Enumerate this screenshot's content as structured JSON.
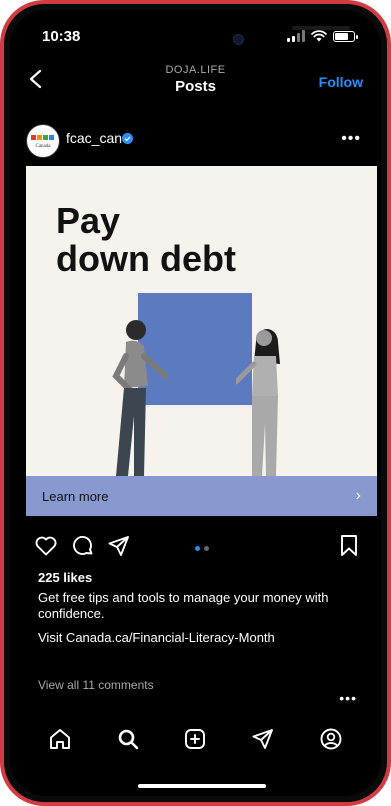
{
  "status_bar": {
    "time": "10:38"
  },
  "nav": {
    "subtitle": "DOJA.LIFE",
    "title": "Posts",
    "follow_label": "Follow"
  },
  "post": {
    "username": "fcac_can",
    "avatar_text": "Canada",
    "headline_line1": "Pay",
    "headline_line2": "down debt",
    "cta_label": "Learn more",
    "likes": "225 likes",
    "caption": "Get free tips and tools to manage your money with confidence.",
    "link_text": "Visit Canada.ca/Financial-Literacy-Month",
    "comments_link": "View all 11 comments",
    "carousel": {
      "count": 2,
      "active": 1
    }
  },
  "colors": {
    "accent": "#1e90ff",
    "phone_case": "#d33b43",
    "cta_band": "#8799cf",
    "box": "#5c7ac0"
  },
  "icons": {
    "actions": [
      "heart-icon",
      "comment-icon",
      "share-icon",
      "bookmark-icon"
    ],
    "tabs": [
      "home-icon",
      "search-icon",
      "create-icon",
      "direct-icon",
      "profile-icon"
    ]
  }
}
